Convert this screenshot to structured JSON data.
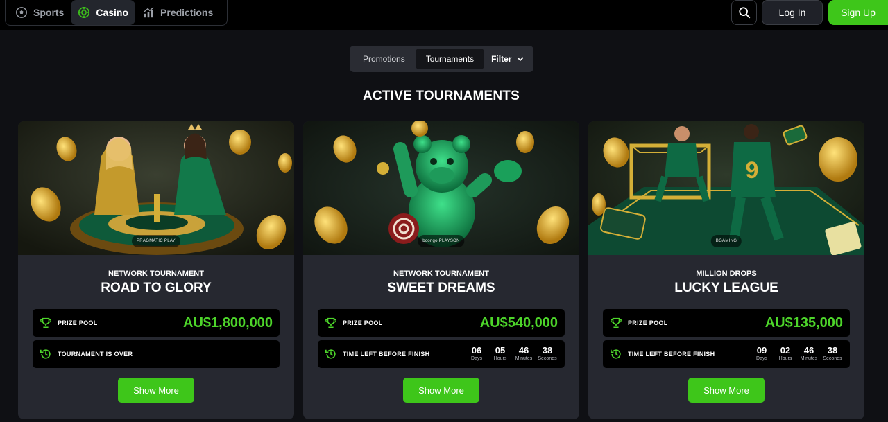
{
  "nav": {
    "items": [
      {
        "label": "Sports",
        "icon": "soccer-ball-icon",
        "active": false
      },
      {
        "label": "Casino",
        "icon": "casino-chip-icon",
        "active": true
      },
      {
        "label": "Predictions",
        "icon": "predictions-chart-icon",
        "active": false
      }
    ]
  },
  "header": {
    "login_label": "Log In",
    "signup_label": "Sign Up"
  },
  "tabs": {
    "promotions": "Promotions",
    "tournaments": "Tournaments",
    "filter": "Filter"
  },
  "section_title": "ACTIVE TOURNAMENTS",
  "colors": {
    "accent_green": "#3ec61a",
    "prize_green": "#4dd52a",
    "card_bg": "#262830",
    "page_bg": "#0f1014"
  },
  "cards": [
    {
      "provider": "PRAGMATIC PLAY",
      "subtitle": "NETWORK TOURNAMENT",
      "title": "ROAD TO GLORY",
      "prize_label": "PRIZE POOL",
      "prize_value": "AU$1,800,000",
      "status_label": "TOURNAMENT IS OVER",
      "button": "Show More"
    },
    {
      "provider": "bcongo  PLAYSON",
      "subtitle": "NETWORK TOURNAMENT",
      "title": "SWEET DREAMS",
      "prize_label": "PRIZE POOL",
      "prize_value": "AU$540,000",
      "status_label": "TIME LEFT BEFORE FINISH",
      "countdown": {
        "days": "06",
        "hours": "05",
        "minutes": "46",
        "seconds": "38"
      },
      "button": "Show More"
    },
    {
      "provider": "BGAMING",
      "subtitle": "MILLION DROPS",
      "title": "LUCKY LEAGUE",
      "prize_label": "PRIZE POOL",
      "prize_value": "AU$135,000",
      "status_label": "TIME LEFT BEFORE FINISH",
      "countdown": {
        "days": "09",
        "hours": "02",
        "minutes": "46",
        "seconds": "38"
      },
      "button": "Show More"
    }
  ],
  "countdown_labels": {
    "days": "Days",
    "hours": "Hours",
    "minutes": "Minutes",
    "seconds": "Seconds"
  }
}
